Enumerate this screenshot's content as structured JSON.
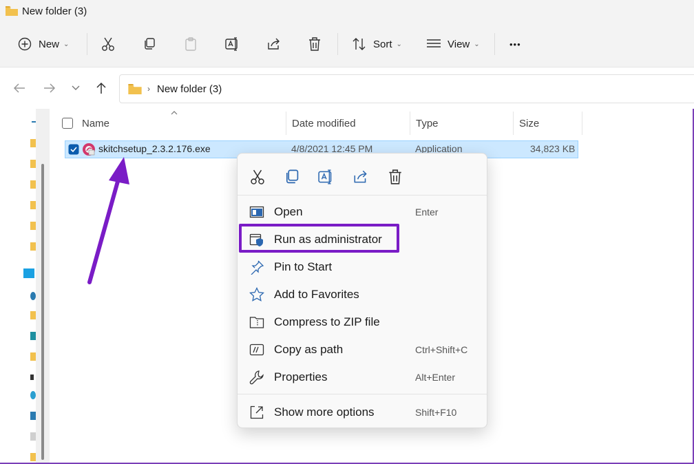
{
  "window": {
    "title": "New folder (3)"
  },
  "toolbar": {
    "new_label": "New",
    "sort_label": "Sort",
    "view_label": "View",
    "more_label": "•••"
  },
  "address": {
    "crumb": "New folder (3)"
  },
  "columns": {
    "name": "Name",
    "date": "Date modified",
    "type": "Type",
    "size": "Size"
  },
  "file": {
    "name": "skitchsetup_2.3.2.176.exe",
    "date": "4/8/2021 12:45 PM",
    "type": "Application",
    "size": "34,823 KB"
  },
  "context_menu": {
    "items": [
      {
        "label": "Open",
        "shortcut": "Enter",
        "icon": "open-icon"
      },
      {
        "label": "Run as administrator",
        "shortcut": "",
        "icon": "shield-app-icon"
      },
      {
        "label": "Pin to Start",
        "shortcut": "",
        "icon": "pin-icon"
      },
      {
        "label": "Add to Favorites",
        "shortcut": "",
        "icon": "star-icon"
      },
      {
        "label": "Compress to ZIP file",
        "shortcut": "",
        "icon": "zip-icon"
      },
      {
        "label": "Copy as path",
        "shortcut": "Ctrl+Shift+C",
        "icon": "path-icon"
      },
      {
        "label": "Properties",
        "shortcut": "Alt+Enter",
        "icon": "wrench-icon"
      },
      {
        "label": "Show more options",
        "shortcut": "Shift+F10",
        "icon": "more-options-icon"
      }
    ]
  },
  "colors": {
    "accent": "#7a1cc6",
    "selection": "#cce8ff",
    "folder": "#f2c14e"
  }
}
